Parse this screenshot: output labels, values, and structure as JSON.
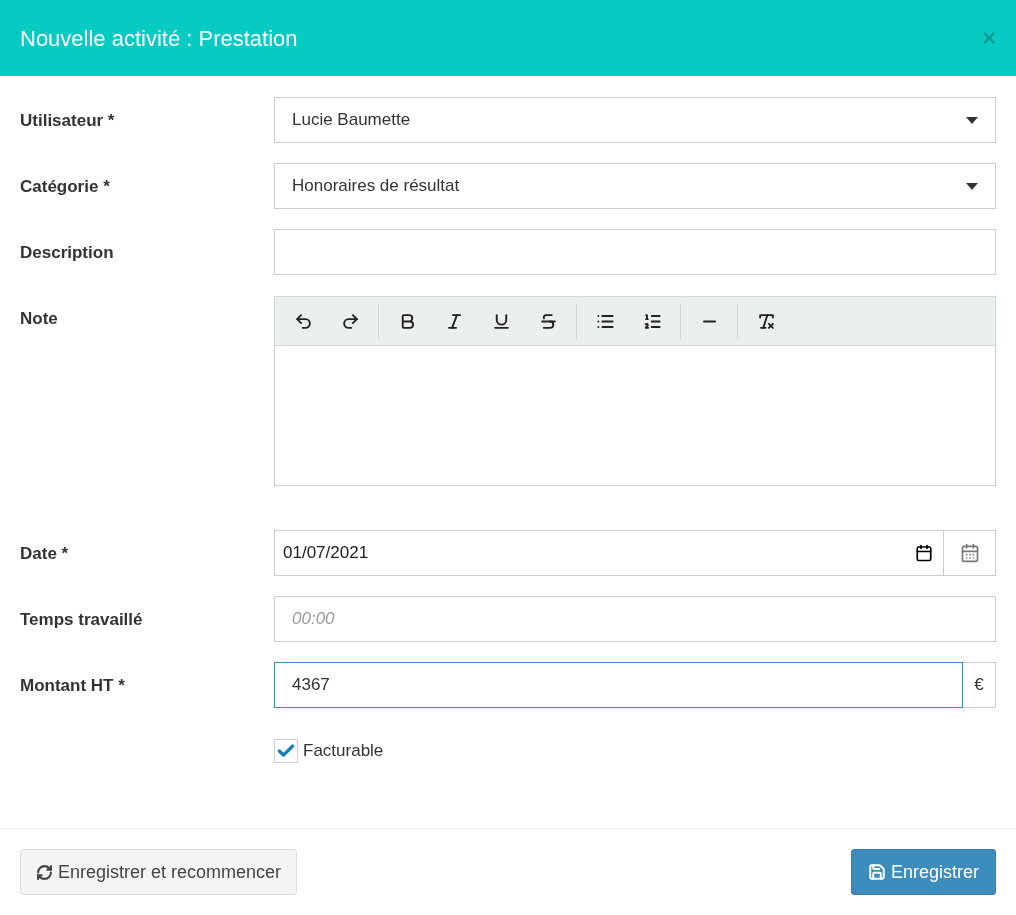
{
  "dialog": {
    "title": "Nouvelle activité : Prestation",
    "close_symbol": "×"
  },
  "fields": [
    {
      "kind": "select",
      "label": "Utilisateur *",
      "value": "Lucie Baumette"
    },
    {
      "kind": "select",
      "label": "Catégorie *",
      "value": "Honoraires de résultat"
    },
    {
      "kind": "text",
      "label": "Description"
    },
    {
      "kind": "editor",
      "label": "Note"
    },
    {
      "kind": "date",
      "label": "Date *",
      "value": "01/07/2021"
    },
    {
      "kind": "text",
      "label": "Temps travaillé",
      "placeholder": "00:00"
    },
    {
      "kind": "money",
      "label": "Montant HT *",
      "value": "4367",
      "unit": "€",
      "focused": true
    },
    {
      "kind": "checkbox",
      "label": "Facturable",
      "checked": true
    }
  ],
  "footer": {
    "secondary_button": "Enregistrer et recommencer",
    "primary_button": "Enregistrer"
  }
}
